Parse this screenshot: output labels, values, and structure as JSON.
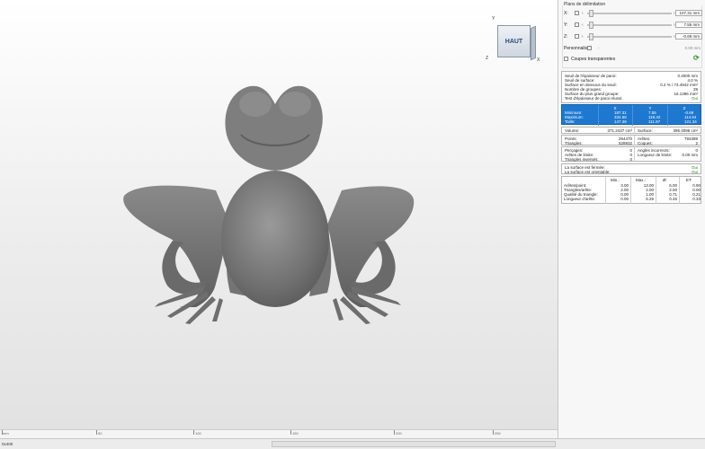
{
  "view": {
    "cube_label": "HAUT",
    "axis_x": "X",
    "axis_y": "Y",
    "axis_z": "Z"
  },
  "ruler": {
    "ticks": [
      "mm",
      "50",
      "100",
      "150",
      "200",
      "250"
    ]
  },
  "status": {
    "coords": "0x400"
  },
  "section": {
    "title": "Plans de délimitation",
    "rows": [
      {
        "label": "X:",
        "value": "107.31 mm"
      },
      {
        "label": "Y:",
        "value": "7.55 mm"
      },
      {
        "label": "Z:",
        "value": "-0.69 mm"
      },
      {
        "label": "Personnalisé",
        "value": "0.00 mm"
      }
    ],
    "transparent_cuts_label": "Coupes transparentes"
  },
  "thickness": {
    "rows": [
      {
        "label": "Seuil de l'épaisseur de paroi:",
        "value": "0.4000 mm"
      },
      {
        "label": "Seuil de surface:",
        "value": "4.0 %"
      },
      {
        "label": "Surface en dessous du seuil:",
        "value": "0.2 % / 73.4942 mm²"
      },
      {
        "label": "Nombre de groupes:",
        "value": "39"
      },
      {
        "label": "Surface du plus grand groupe:",
        "value": "16.1396 mm²"
      },
      {
        "label": "Test d'épaisseur de paroi réussi:",
        "value": "Oui"
      }
    ]
  },
  "bounds": {
    "headers": [
      "X",
      "Y",
      "Z"
    ],
    "rows": [
      {
        "label": "Minimum:",
        "values": [
          "187.31",
          "7.55",
          "-0.69"
        ]
      },
      {
        "label": "Maximum:",
        "values": [
          "334.66",
          "119.42",
          "114.64"
        ]
      },
      {
        "label": "Taille:",
        "values": [
          "147.36",
          "111.87",
          "121.34"
        ]
      }
    ]
  },
  "volume": {
    "volume_label": "Volume:",
    "volume_value": "371.2437 cm³",
    "surface_label": "Surface:",
    "surface_value": "395.4096 cm²"
  },
  "counts": {
    "left": [
      {
        "label": "Points:",
        "value": "264470"
      },
      {
        "label": "Triangles:",
        "value": "528932"
      }
    ],
    "right": [
      {
        "label": "Arêtes:",
        "value": "793398"
      },
      {
        "label": "Coques:",
        "value": "2"
      }
    ]
  },
  "errors": {
    "left": [
      {
        "label": "Perçages:",
        "value": "0"
      },
      {
        "label": "Arêtes de limite:",
        "value": "0"
      },
      {
        "label": "Triangles inversés:",
        "value": "0"
      }
    ],
    "right": [
      {
        "label": "Angles incorrects:",
        "value": "0"
      },
      {
        "label": "Longueur de limite:",
        "value": "0.00 mm"
      }
    ]
  },
  "closed": {
    "rows": [
      {
        "label": "La surface est fermée:",
        "value": "Oui"
      },
      {
        "label": "La surface est orientable:",
        "value": "Oui"
      }
    ]
  },
  "quality": {
    "headers": [
      "Min.:",
      "Max.:",
      "Ø:",
      "ET:"
    ],
    "rows": [
      {
        "label": "Arêtes/point:",
        "values": [
          "3.00",
          "13.00",
          "6.00",
          "0.90"
        ]
      },
      {
        "label": "Triangles/arête:",
        "values": [
          "2.00",
          "2.00",
          "2.00",
          "0.00"
        ]
      },
      {
        "label": "Qualité du triangle:",
        "values": [
          "0.00",
          "1.00",
          "0.71",
          "0.21"
        ]
      },
      {
        "label": "Longueur d'arête:",
        "values": [
          "0.00",
          "6.28",
          "0.45",
          "0.33"
        ]
      }
    ]
  },
  "colors": {
    "accent": "#1e78d0",
    "ok": "#2a8a2a",
    "model": "#7b7b7b"
  }
}
